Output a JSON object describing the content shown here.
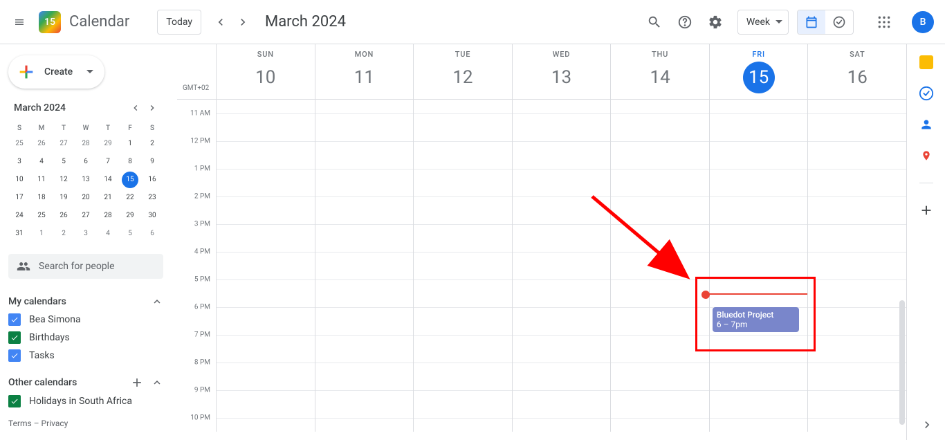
{
  "header": {
    "app_name": "Calendar",
    "logo_day": "15",
    "today_label": "Today",
    "month_title": "March 2024",
    "view_label": "Week",
    "avatar_letter": "B"
  },
  "sidebar": {
    "create_label": "Create",
    "mini_title": "March 2024",
    "dows": [
      "S",
      "M",
      "T",
      "W",
      "T",
      "F",
      "S"
    ],
    "mini_days": [
      {
        "n": "25",
        "o": true
      },
      {
        "n": "26",
        "o": true
      },
      {
        "n": "27",
        "o": true
      },
      {
        "n": "28",
        "o": true
      },
      {
        "n": "29",
        "o": true
      },
      {
        "n": "1"
      },
      {
        "n": "2"
      },
      {
        "n": "3"
      },
      {
        "n": "4"
      },
      {
        "n": "5"
      },
      {
        "n": "6"
      },
      {
        "n": "7"
      },
      {
        "n": "8"
      },
      {
        "n": "9"
      },
      {
        "n": "10"
      },
      {
        "n": "11"
      },
      {
        "n": "12"
      },
      {
        "n": "13"
      },
      {
        "n": "14"
      },
      {
        "n": "15",
        "today": true
      },
      {
        "n": "16"
      },
      {
        "n": "17"
      },
      {
        "n": "18"
      },
      {
        "n": "19"
      },
      {
        "n": "20"
      },
      {
        "n": "21"
      },
      {
        "n": "22"
      },
      {
        "n": "23"
      },
      {
        "n": "24"
      },
      {
        "n": "25"
      },
      {
        "n": "26"
      },
      {
        "n": "27"
      },
      {
        "n": "28"
      },
      {
        "n": "29"
      },
      {
        "n": "30"
      },
      {
        "n": "31"
      },
      {
        "n": "1",
        "o": true
      },
      {
        "n": "2",
        "o": true
      },
      {
        "n": "3",
        "o": true
      },
      {
        "n": "4",
        "o": true
      },
      {
        "n": "5",
        "o": true
      },
      {
        "n": "6",
        "o": true
      }
    ],
    "search_placeholder": "Search for people",
    "my_calendars_label": "My calendars",
    "my_calendars": [
      {
        "label": "Bea Simona",
        "color": "#4285f4"
      },
      {
        "label": "Birthdays",
        "color": "#0b8043"
      },
      {
        "label": "Tasks",
        "color": "#4285f4"
      }
    ],
    "other_calendars_label": "Other calendars",
    "other_calendars": [
      {
        "label": "Holidays in South Africa",
        "color": "#0b8043"
      }
    ],
    "footer": "Terms – Privacy"
  },
  "grid": {
    "timezone": "GMT+02",
    "days": [
      {
        "dow": "SUN",
        "num": "10"
      },
      {
        "dow": "MON",
        "num": "11"
      },
      {
        "dow": "TUE",
        "num": "12"
      },
      {
        "dow": "WED",
        "num": "13"
      },
      {
        "dow": "THU",
        "num": "14"
      },
      {
        "dow": "FRI",
        "num": "15",
        "today": true
      },
      {
        "dow": "SAT",
        "num": "16"
      }
    ],
    "hours": [
      "11 AM",
      "12 PM",
      "1 PM",
      "2 PM",
      "3 PM",
      "4 PM",
      "5 PM",
      "6 PM",
      "7 PM",
      "8 PM",
      "9 PM",
      "10 PM"
    ],
    "event": {
      "title": "Bluedot Project",
      "time": "6 – 7pm"
    }
  }
}
